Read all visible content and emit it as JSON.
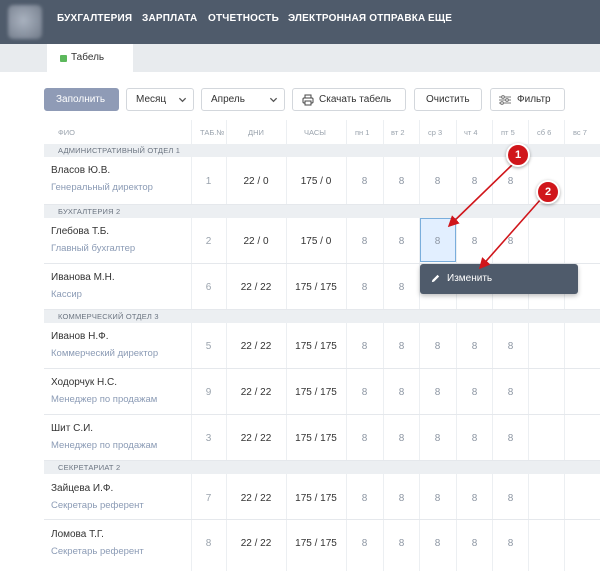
{
  "nav": {
    "items": [
      "БУХГАЛТЕРИЯ",
      "ЗАРПЛАТА",
      "ОТЧЕТНОСТЬ",
      "ЭЛЕКТРОННАЯ ОТПРАВКА",
      "ЕЩЕ"
    ]
  },
  "tab": {
    "label": "Табель",
    "status_color": "#5cb85c"
  },
  "toolbar": {
    "fill_label": "Заполнить",
    "period_select": "Месяц",
    "month_select": "Апрель",
    "download_label": "Скачать табель",
    "clear_label": "Очистить",
    "filter_label": "Фильтр"
  },
  "columns": {
    "name": "ФИО",
    "tab_no": "ТАБ.№",
    "days": "ДНИ",
    "hours": "ЧАСЫ",
    "weekdays": [
      "пн 1",
      "вт 2",
      "ср 3",
      "чт 4",
      "пт 5",
      "сб 6",
      "вс 7"
    ]
  },
  "departments": [
    {
      "name": "АДМИНИСТРАТИВНЫЙ ОТДЕЛ 1",
      "employees": [
        {
          "name": "Власов Ю.В.",
          "position": "Генеральный директор",
          "tab_no": "1",
          "days": "22 / 0",
          "hours": "175 / 0",
          "day_values": [
            "8",
            "8",
            "8",
            "8",
            "8"
          ]
        }
      ]
    },
    {
      "name": "БУХГАЛТЕРИЯ 2",
      "employees": [
        {
          "name": "Глебова Т.Б.",
          "position": "Главный бухгалтер",
          "tab_no": "2",
          "days": "22 / 0",
          "hours": "175 / 0",
          "day_values": [
            "8",
            "8",
            "8",
            "8",
            "8"
          ]
        },
        {
          "name": "Иванова М.Н.",
          "position": "Кассир",
          "tab_no": "6",
          "days": "22 / 22",
          "hours": "175 / 175",
          "day_values": [
            "8",
            "8"
          ]
        }
      ]
    },
    {
      "name": "КОММЕРЧЕСКИЙ ОТДЕЛ 3",
      "employees": [
        {
          "name": "Иванов Н.Ф.",
          "position": "Коммерческий директор",
          "tab_no": "5",
          "days": "22 / 22",
          "hours": "175 / 175",
          "day_values": [
            "8",
            "8",
            "8",
            "8",
            "8"
          ]
        },
        {
          "name": "Ходорчук Н.С.",
          "position": "Менеджер по продажам",
          "tab_no": "9",
          "days": "22 / 22",
          "hours": "175 / 175",
          "day_values": [
            "8",
            "8",
            "8",
            "8",
            "8"
          ]
        },
        {
          "name": "Шит С.И.",
          "position": "Менеджер по продажам",
          "tab_no": "3",
          "days": "22 / 22",
          "hours": "175 / 175",
          "day_values": [
            "8",
            "8",
            "8",
            "8",
            "8"
          ]
        }
      ]
    },
    {
      "name": "СЕКРЕТАРИАТ 2",
      "employees": [
        {
          "name": "Зайцева И.Ф.",
          "position": "Секретарь референт",
          "tab_no": "7",
          "days": "22 / 22",
          "hours": "175 / 175",
          "day_values": [
            "8",
            "8",
            "8",
            "8",
            "8"
          ]
        },
        {
          "name": "Ломова Т.Г.",
          "position": "Секретарь референт",
          "tab_no": "8",
          "days": "22 / 22",
          "hours": "175 / 175",
          "day_values": [
            "8",
            "8",
            "8",
            "8",
            "8"
          ]
        }
      ]
    }
  ],
  "context_menu": {
    "edit_label": "Изменить"
  },
  "annotations": {
    "badge_1": "1",
    "badge_2": "2",
    "color": "#d0161b"
  }
}
